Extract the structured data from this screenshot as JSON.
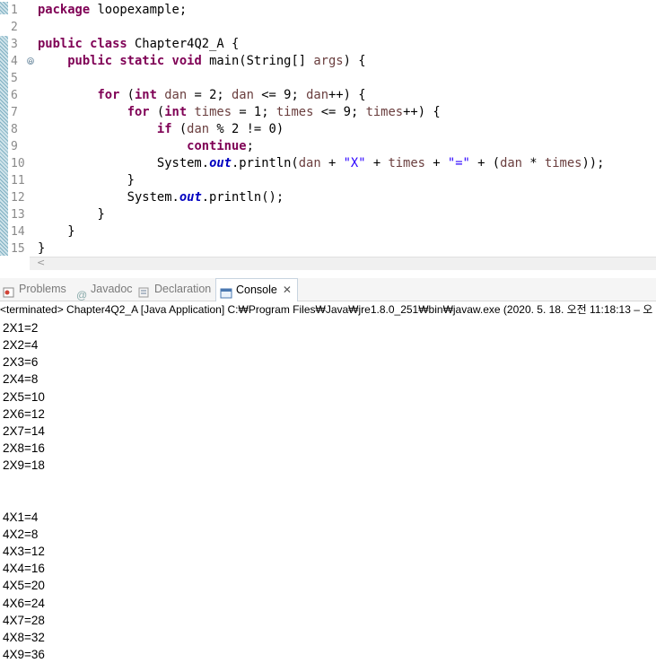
{
  "editor": {
    "line_numbers": [
      "1",
      "2",
      "3",
      "4",
      "5",
      "6",
      "7",
      "8",
      "9",
      "10",
      "11",
      "12",
      "13",
      "14",
      "15"
    ],
    "fold_marker": "⊖",
    "lines": [
      [
        [
          "kw",
          "package"
        ],
        [
          "p",
          " loopexample;"
        ]
      ],
      [],
      [
        [
          "kw",
          "public class"
        ],
        [
          "p",
          " Chapter4Q2_A {"
        ]
      ],
      [
        [
          "p",
          "    "
        ],
        [
          "kw",
          "public static void"
        ],
        [
          "p",
          " main(String[] "
        ],
        [
          "var",
          "args"
        ],
        [
          "p",
          ") {"
        ]
      ],
      [],
      [
        [
          "p",
          "        "
        ],
        [
          "kw",
          "for"
        ],
        [
          "p",
          " ("
        ],
        [
          "kw",
          "int"
        ],
        [
          "p",
          " "
        ],
        [
          "var",
          "dan"
        ],
        [
          "p",
          " = 2; "
        ],
        [
          "var",
          "dan"
        ],
        [
          "p",
          " <= 9; "
        ],
        [
          "var",
          "dan"
        ],
        [
          "p",
          "++) {"
        ]
      ],
      [
        [
          "p",
          "            "
        ],
        [
          "kw",
          "for"
        ],
        [
          "p",
          " ("
        ],
        [
          "kw",
          "int"
        ],
        [
          "p",
          " "
        ],
        [
          "var",
          "times"
        ],
        [
          "p",
          " = 1; "
        ],
        [
          "var",
          "times"
        ],
        [
          "p",
          " <= 9; "
        ],
        [
          "var",
          "times"
        ],
        [
          "p",
          "++) {"
        ]
      ],
      [
        [
          "p",
          "                "
        ],
        [
          "kw",
          "if"
        ],
        [
          "p",
          " ("
        ],
        [
          "var",
          "dan"
        ],
        [
          "p",
          " % 2 != 0)"
        ]
      ],
      [
        [
          "p",
          "                    "
        ],
        [
          "kw",
          "continue"
        ],
        [
          "p",
          ";"
        ]
      ],
      [
        [
          "p",
          "                System."
        ],
        [
          "fld",
          "out"
        ],
        [
          "p",
          ".println("
        ],
        [
          "var",
          "dan"
        ],
        [
          "p",
          " + "
        ],
        [
          "str",
          "\"X\""
        ],
        [
          "p",
          " + "
        ],
        [
          "var",
          "times"
        ],
        [
          "p",
          " + "
        ],
        [
          "str",
          "\"=\""
        ],
        [
          "p",
          " + ("
        ],
        [
          "var",
          "dan"
        ],
        [
          "p",
          " * "
        ],
        [
          "var",
          "times"
        ],
        [
          "p",
          "));"
        ]
      ],
      [
        [
          "p",
          "            }"
        ]
      ],
      [
        [
          "p",
          "            System."
        ],
        [
          "fld",
          "out"
        ],
        [
          "p",
          ".println();"
        ]
      ],
      [
        [
          "p",
          "        }"
        ]
      ],
      [
        [
          "p",
          "    }"
        ]
      ],
      [
        [
          "p",
          "}"
        ]
      ]
    ],
    "scroll_arrow": "<"
  },
  "console": {
    "tabs": [
      {
        "label": "Problems",
        "icon": "problems-icon",
        "active": false
      },
      {
        "label": "Javadoc",
        "icon": "javadoc-at-icon",
        "active": false
      },
      {
        "label": "Declaration",
        "icon": "declaration-icon",
        "active": false
      },
      {
        "label": "Console",
        "icon": "console-icon",
        "active": true
      }
    ],
    "close_glyph": "✕",
    "status": "<terminated> Chapter4Q2_A [Java Application] C:₩Program Files₩Java₩jre1.8.0_251₩bin₩javaw.exe  (2020. 5. 18. 오전 11:18:13 – 오",
    "output": [
      "2X1=2",
      "2X2=4",
      "2X3=6",
      "2X4=8",
      "2X5=10",
      "2X6=12",
      "2X7=14",
      "2X8=16",
      "2X9=18",
      "",
      "",
      "4X1=4",
      "4X2=8",
      "4X3=12",
      "4X4=16",
      "4X5=20",
      "4X6=24",
      "4X7=28",
      "4X8=32",
      "4X9=36"
    ]
  },
  "colors": {
    "keyword": "#7f0055",
    "string": "#2a00ff",
    "field": "#0000c0",
    "variable": "#6a3e3e"
  }
}
